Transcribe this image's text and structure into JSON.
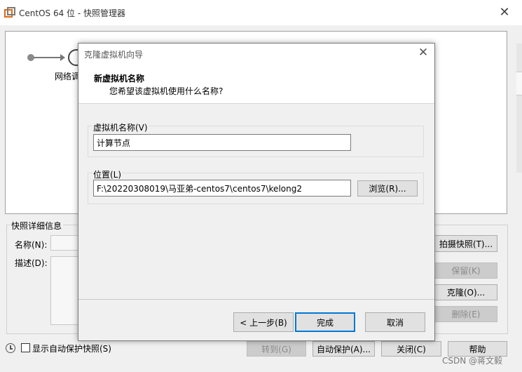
{
  "window": {
    "title": "CentOS 64 位 - 快照管理器",
    "close_glyph": "✕"
  },
  "timeline": {
    "node_label": "网络调"
  },
  "details": {
    "legend": "快照详细信息",
    "name_label": "名称(N):",
    "description_label": "描述(D):"
  },
  "right_buttons": {
    "take_snapshot": "拍摄快照(T)...",
    "keep": "保留(K)",
    "clone": "克隆(O)...",
    "delete": "删除(E)"
  },
  "footer": {
    "checkbox_label": "显示自动保护快照(S)",
    "checkbox_checked": false,
    "goto": "转到(G)",
    "autoprotect": "自动保护(A)...",
    "close": "关闭(C)",
    "help": "帮助"
  },
  "dialog": {
    "title": "克隆虚拟机向导",
    "close_glyph": "✕",
    "heading": "新虚拟机名称",
    "subheading": "您希望该虚拟机使用什么名称?",
    "vm_name_label": "虚拟机名称(V)",
    "vm_name_value": "计算节点",
    "location_label": "位置(L)",
    "location_value": "F:\\20220308019\\马亚弟-centos7\\centos7\\kelong2",
    "browse": "浏览(R)...",
    "back": "< 上一步(B)",
    "finish": "完成",
    "cancel": "取消"
  },
  "watermark": "CSDN @蒋文毅",
  "colors": {
    "focus_border": "#0078d7",
    "window_bg": "#f0f0f0",
    "button_bg": "#e1e1e1"
  }
}
